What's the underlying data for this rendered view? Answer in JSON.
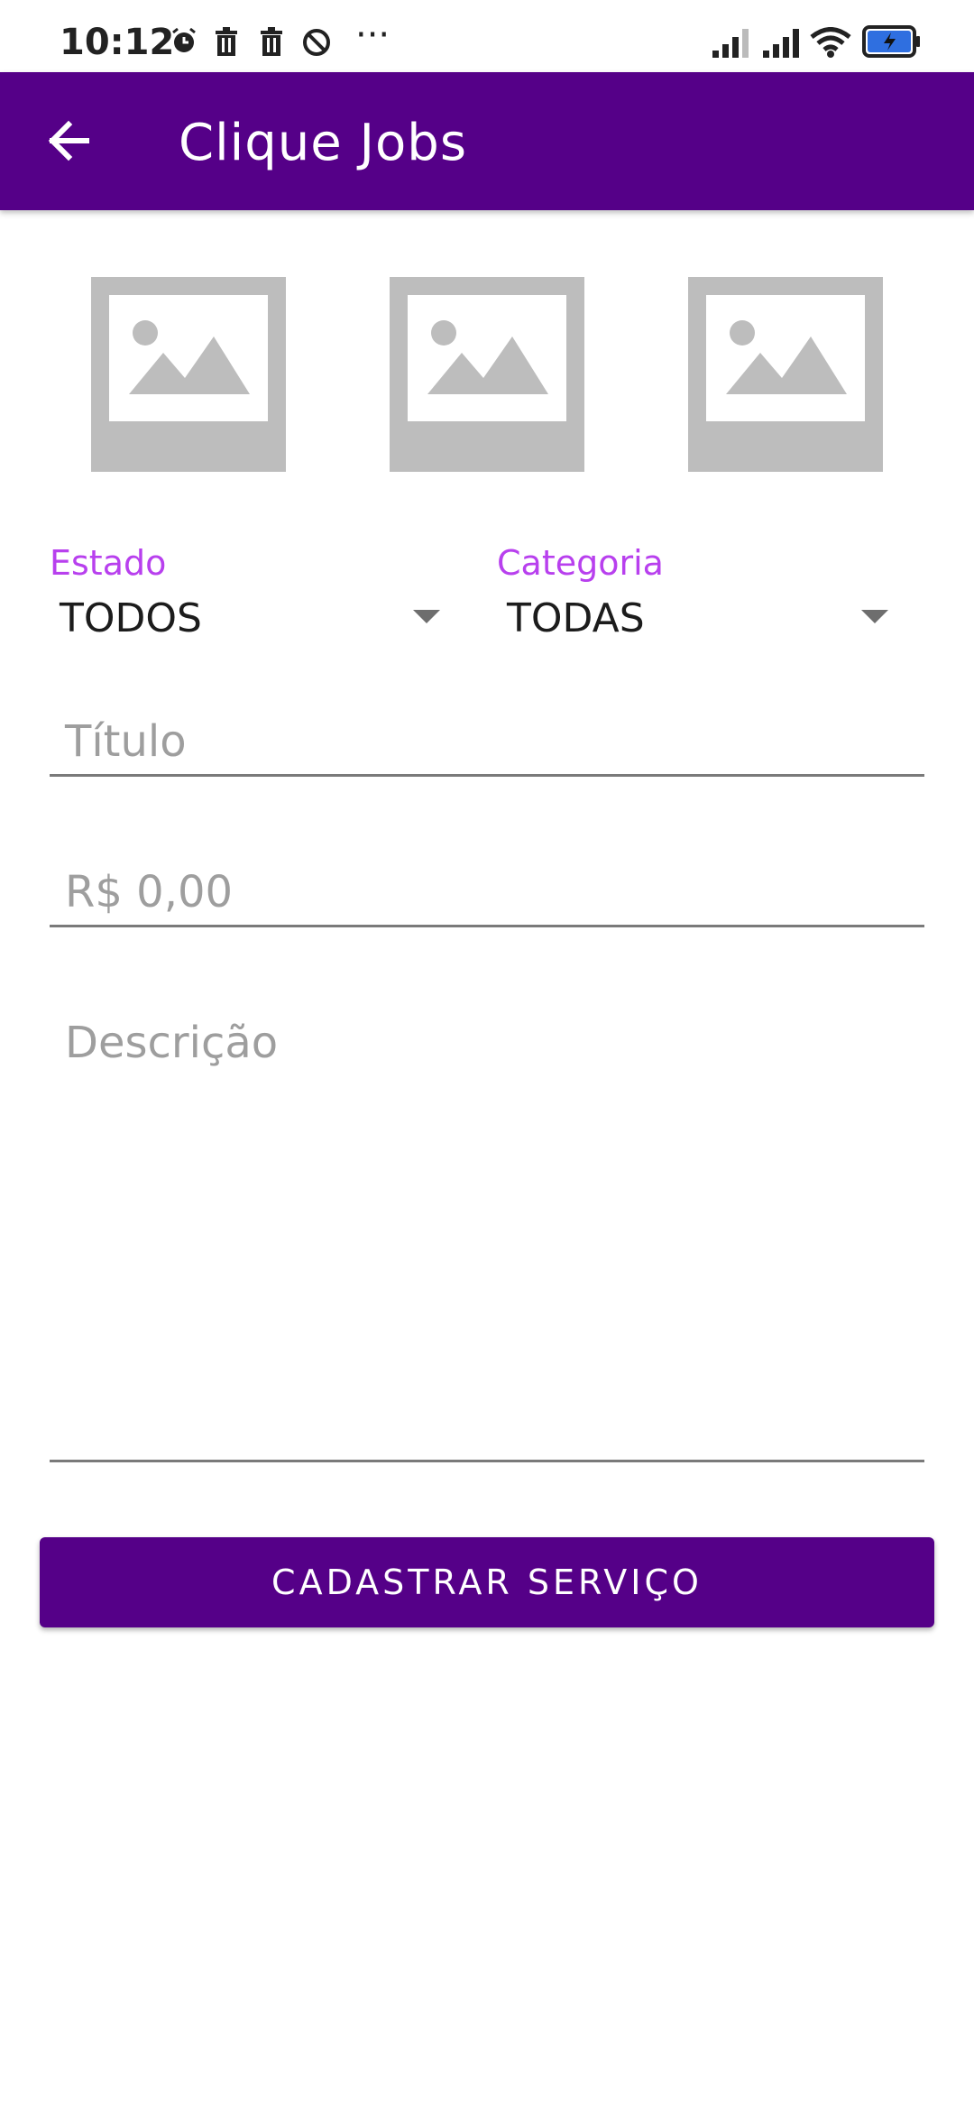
{
  "status_bar": {
    "time": "10:12",
    "more": "···",
    "icons": [
      "alarm-icon",
      "trash-icon",
      "trash-icon",
      "block-icon",
      "signal-icon",
      "signal-icon",
      "wifi-icon",
      "battery-icon"
    ]
  },
  "app_bar": {
    "title": "Clique Jobs",
    "back_icon": "arrow-left-icon"
  },
  "images": {
    "icon": "image-placeholder-icon",
    "count": 3
  },
  "filters": {
    "estado": {
      "label": "Estado",
      "value": "TODOS"
    },
    "categoria": {
      "label": "Categoria",
      "value": "TODAS"
    }
  },
  "form": {
    "titulo_placeholder": "Título",
    "preco_placeholder": "R$ 0,00",
    "descricao_placeholder": "Descrição"
  },
  "submit_button": {
    "label": "CADASTRAR SERVIÇO"
  },
  "colors": {
    "primary": "#550088",
    "label_accent": "#B840EE",
    "placeholder": "#9E9E9E",
    "image_placeholder": "#BDBDBD"
  }
}
